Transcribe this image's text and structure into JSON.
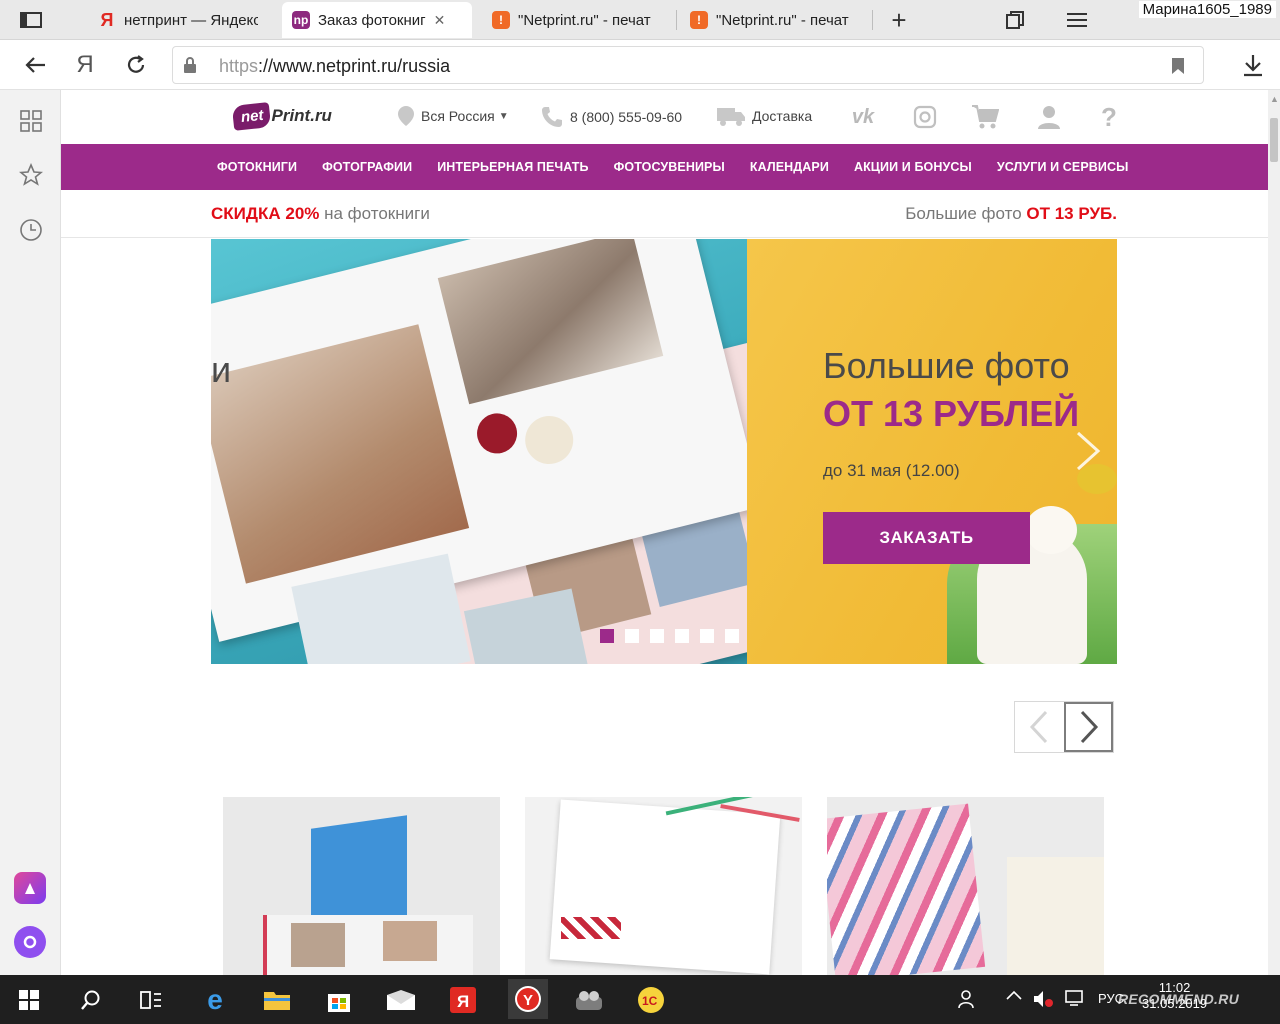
{
  "browser": {
    "tabs": [
      {
        "label": "нетпринт — Яндекс",
        "icon": "yandex-favicon",
        "color": "#e02a23"
      },
      {
        "label": "Заказ фотокниг",
        "icon": "netprint-favicon",
        "color": "#8d2a7f"
      },
      {
        "label": "\"Netprint.ru\" - печат",
        "icon": "otzovik-favicon",
        "color": "#f06a27"
      },
      {
        "label": "\"Netprint.ru\" - печат",
        "icon": "otzovik-favicon",
        "color": "#f06a27"
      }
    ],
    "user_name": "Марина1605_1989",
    "address": {
      "scheme": "https",
      "rest": "://www.netprint.ru/russia"
    },
    "yandex_glyph": "Я"
  },
  "site": {
    "logo": {
      "badge": "net",
      "brand": "Print.ru"
    },
    "region": "Вся Россия",
    "phone": "8 (800) 555-09-60",
    "delivery": "Доставка",
    "vk": "vk",
    "menu": [
      "ФОТОКНИГИ",
      "ФОТОГРАФИИ",
      "ИНТЕРЬЕРНАЯ ПЕЧАТЬ",
      "ФОТОСУВЕНИРЫ",
      "КАЛЕНДАРИ",
      "АКЦИИ И БОНУСЫ",
      "УСЛУГИ И СЕРВИСЫ"
    ],
    "promo_left": {
      "accent": "СКИДКА 20%",
      "rest": " на фотокниги"
    },
    "promo_right": {
      "rest": "Большие фото ",
      "accent": "ОТ 13 РУБ."
    },
    "banner": {
      "title": "Большие фото",
      "subtitle": "ОТ 13 РУБЛЕЙ",
      "date": "до 31 мая (12.00)",
      "button": "ЗАКАЗАТЬ",
      "bleed_letter": "и",
      "slide_count": 6,
      "active_slide": 1
    }
  },
  "taskbar": {
    "lang": "РУС",
    "time": "11:02",
    "date": "31.05.2019",
    "watermark": "RECOMMEND.RU"
  },
  "colors": {
    "brand_purple": "#9c2a8a",
    "accent_red": "#e10d17",
    "banner_yellow": "#f3c13f"
  }
}
